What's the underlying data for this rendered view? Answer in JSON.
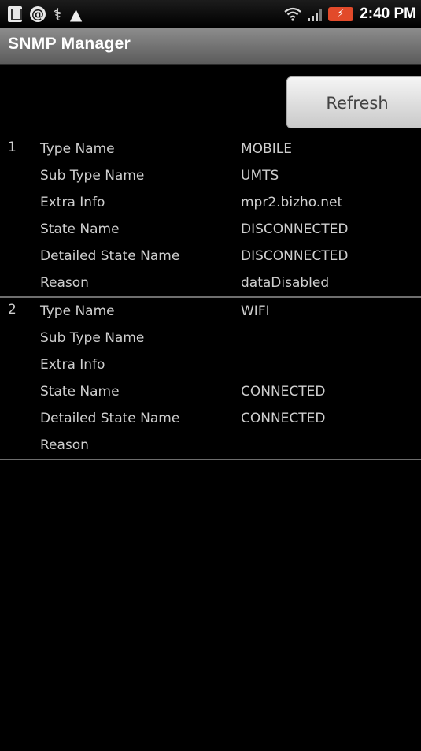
{
  "status_bar": {
    "time": "2:40 PM",
    "icons": [
      "bag-icon",
      "at-icon",
      "usb-icon",
      "warning-icon",
      "wifi-icon",
      "signal-icon",
      "battery-charging-icon"
    ]
  },
  "app": {
    "title": "SNMP Manager"
  },
  "toolbar": {
    "refresh_label": "Refresh"
  },
  "records": [
    {
      "index": "1",
      "fields": [
        {
          "label": "Type Name",
          "value": "MOBILE"
        },
        {
          "label": "Sub Type Name",
          "value": "UMTS"
        },
        {
          "label": "Extra Info",
          "value": "mpr2.bizho.net"
        },
        {
          "label": "State Name",
          "value": "DISCONNECTED"
        },
        {
          "label": "Detailed State Name",
          "value": "DISCONNECTED"
        },
        {
          "label": "Reason",
          "value": "dataDisabled"
        }
      ]
    },
    {
      "index": "2",
      "fields": [
        {
          "label": "Type Name",
          "value": "WIFI"
        },
        {
          "label": "Sub Type Name",
          "value": ""
        },
        {
          "label": "Extra Info",
          "value": ""
        },
        {
          "label": "State Name",
          "value": "CONNECTED"
        },
        {
          "label": "Detailed State Name",
          "value": "CONNECTED"
        },
        {
          "label": "Reason",
          "value": ""
        }
      ]
    }
  ]
}
